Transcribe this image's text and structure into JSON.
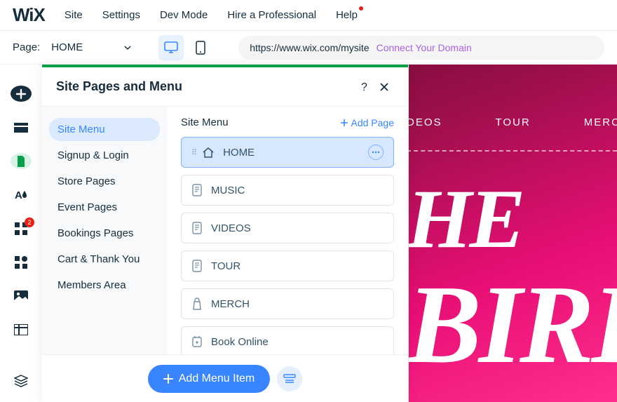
{
  "menubar": {
    "logo": "WiX",
    "items": [
      "Site",
      "Settings",
      "Dev Mode",
      "Hire a Professional",
      "Help"
    ]
  },
  "pagebar": {
    "label": "Page:",
    "current": "HOME",
    "url": "https://www.wix.com/mysite",
    "connect": "Connect Your Domain"
  },
  "toolrail": {
    "badge_count": "2"
  },
  "panel": {
    "title": "Site Pages and Menu",
    "categories": [
      "Site Menu",
      "Signup & Login",
      "Store Pages",
      "Event Pages",
      "Bookings Pages",
      "Cart & Thank You",
      "Members Area"
    ],
    "right_title": "Site Menu",
    "add_page_label": "Add Page",
    "pages": [
      "HOME",
      "MUSIC",
      "VIDEOS",
      "TOUR",
      "MERCH",
      "Book Online"
    ],
    "add_menu_label": "Add Menu Item"
  },
  "canvas": {
    "nav": [
      "DEOS",
      "TOUR",
      "MERCH"
    ],
    "word1": "HE",
    "word2": "BIRDS"
  }
}
